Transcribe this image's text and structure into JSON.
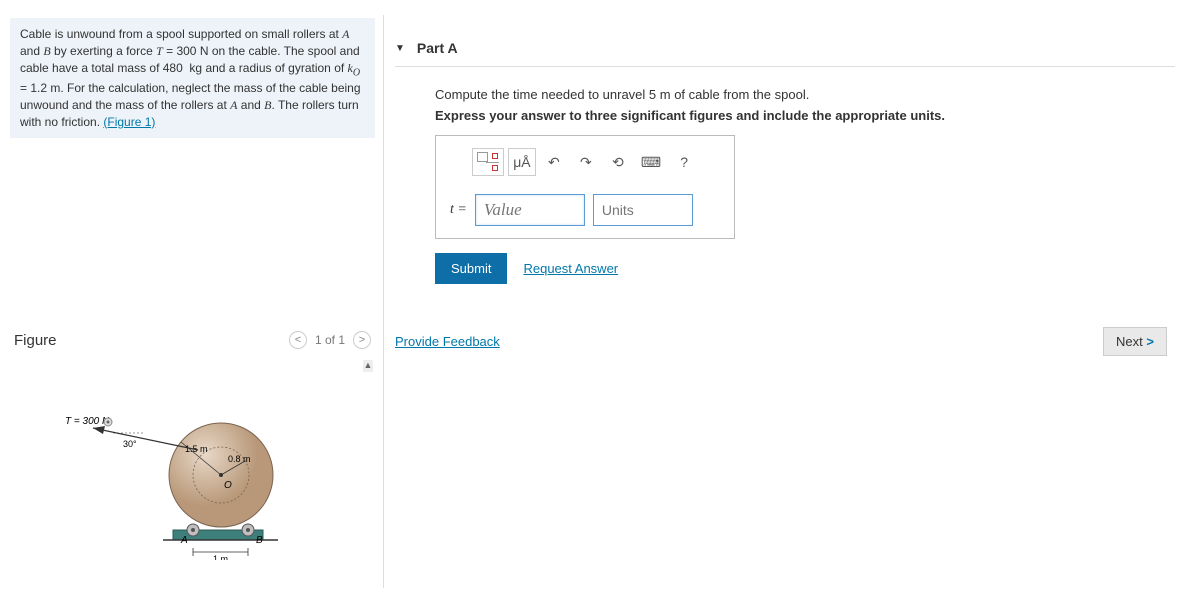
{
  "problem": {
    "text_html": "Cable is unwound from a spool supported on small rollers at <i>A</i> and <i>B</i> by exerting a force <i>T</i> = 300 N on the cable. The spool and cable have a total mass of 480&nbsp;&nbsp;kg and a radius of gyration of <i>k<sub>O</sub></i> = 1.2 m. For the calculation, neglect the mass of the cable being unwound and the mass of the rollers at <i>A</i> and <i>B</i>. The rollers turn with no friction. ",
    "figure_link": "(Figure 1)"
  },
  "figure": {
    "title": "Figure",
    "counter": "1 of 1",
    "labels": {
      "force": "T = 300 N",
      "angle": "30°",
      "outer_r": "1.5 m",
      "inner_r": "0.8 m",
      "center": "O",
      "left_roller": "A",
      "right_roller": "B",
      "base_width": "1 m"
    }
  },
  "part": {
    "title": "Part A",
    "instruction": "Compute the time needed to unravel 5 m of cable from the spool.",
    "express": "Express your answer to three significant figures and include the appropriate units.",
    "var": "t =",
    "value_placeholder": "Value",
    "units_placeholder": "Units",
    "submit": "Submit",
    "request_answer": "Request Answer",
    "mu_label": "μÅ",
    "help": "?"
  },
  "footer": {
    "feedback": "Provide Feedback",
    "next": "Next"
  }
}
